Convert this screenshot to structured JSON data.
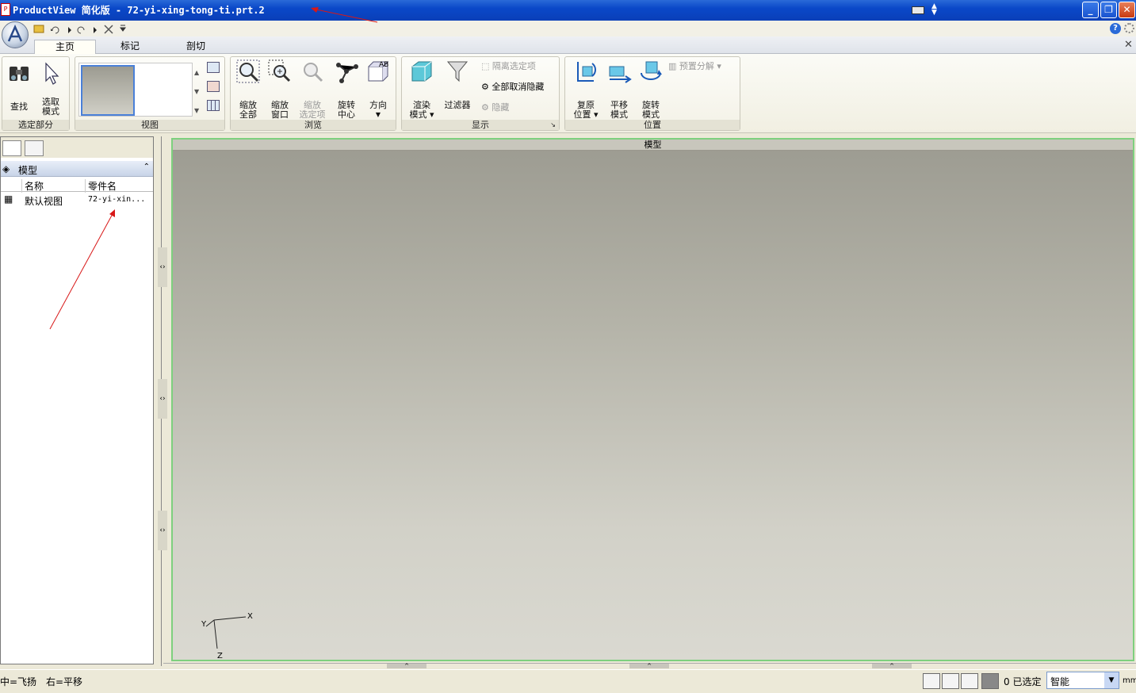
{
  "window": {
    "title": "ProductView 简化版 - 72-yi-xing-tong-ti.prt.2",
    "minimize": "_",
    "restore": "❐",
    "close": "✕"
  },
  "ribbon_tabs": [
    "主页",
    "标记",
    "剖切"
  ],
  "groups": {
    "select": {
      "label": "选定部分",
      "find": "查找",
      "pick_mode_1": "选取",
      "pick_mode_2": "模式"
    },
    "view": {
      "label": "视图"
    },
    "browse": {
      "label": "浏览",
      "zoom_all_1": "缩放",
      "zoom_all_2": "全部",
      "zoom_window_1": "缩放",
      "zoom_window_2": "窗口",
      "zoom_sel_1": "缩放",
      "zoom_sel_2": "选定项",
      "rotate_center_1": "旋转",
      "rotate_center_2": "中心",
      "orientation": "方向"
    },
    "display": {
      "label": "显示",
      "render_1": "渲染",
      "render_2": "模式",
      "filter": "过滤器",
      "isolate": "隔离选定项",
      "unhide_all": "全部取消隐藏",
      "hide": "隐藏"
    },
    "position": {
      "label": "位置",
      "reset_1": "复原",
      "reset_2": "位置",
      "pan_1": "平移",
      "pan_2": "模式",
      "rotate_1": "旋转",
      "rotate_2": "模式",
      "explode": "预置分解"
    }
  },
  "left_panel": {
    "section_title": "模型",
    "columns": [
      "名称",
      "零件名"
    ],
    "rows": [
      {
        "name": "默认视图",
        "part": "72-yi-xin..."
      }
    ]
  },
  "viewport": {
    "header": "模型",
    "axes": {
      "x": "X",
      "y": "Y",
      "z": "Z"
    }
  },
  "status": {
    "middle": "中=飞扬",
    "right": "右=平移",
    "selected": "0 已选定",
    "mode": "智能",
    "unit": "mm"
  },
  "colors": {
    "titlebar": "#0a48c8",
    "viewport_border": "#7ed07e",
    "annotation_arrow": "#d81818"
  }
}
